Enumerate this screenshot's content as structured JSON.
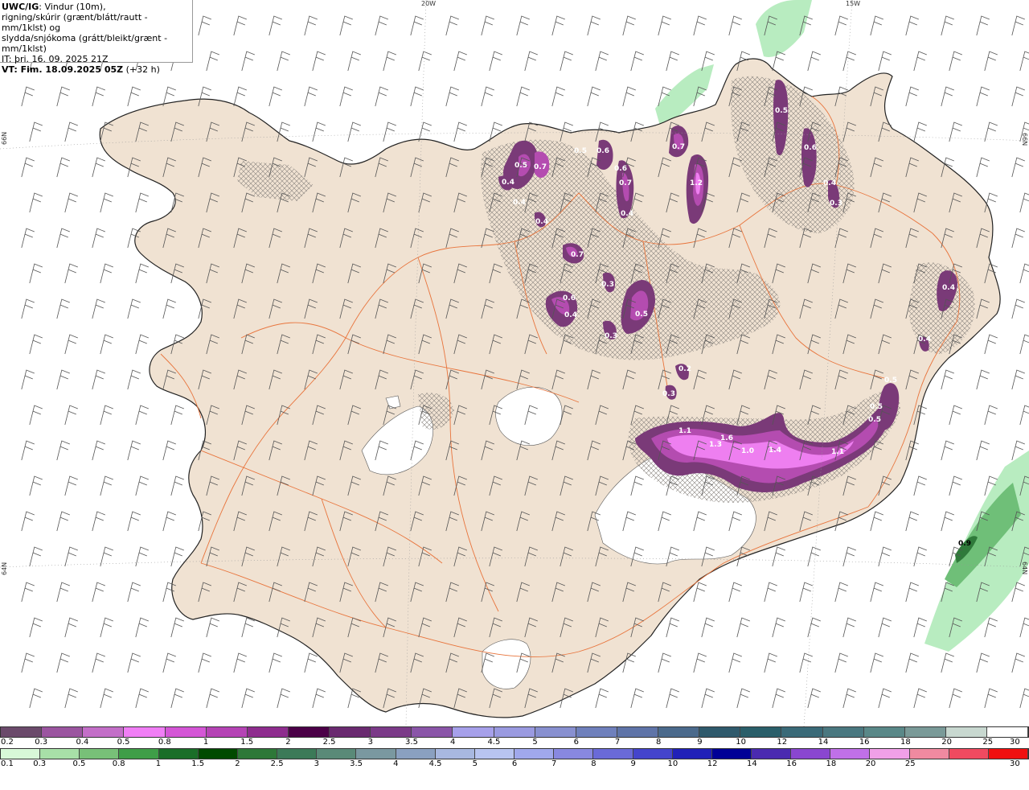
{
  "info": {
    "model": "UWC/IG",
    "title_rest": ": Vindur (10m),",
    "line2": "rigning/skúrir (grænt/blátt/rautt - mm/1klst) og",
    "line3": "slydda/snjókoma (grátt/bleikt/grænt - mm/1klst)",
    "it": "IT: þri. 16. 09. 2025 21Z",
    "vt_bold": "VT: Fim. 18.09.2025 05Z",
    "vt_rest": " (+32 h)"
  },
  "coords": {
    "lon_20": "20W",
    "lon_15": "15W",
    "lat_66_left": "66N",
    "lat_66_right": "66N",
    "lat_64_left": "64N",
    "lat_64_right": "64N"
  },
  "colors": {
    "land": "#f0e2d2",
    "ice": "#ffffff",
    "roads": "#e8743c",
    "wind": "#555555",
    "snow_dark": "#7a3a78",
    "snow_mid": "#b44cb0",
    "snow_light": "#ee7ff0",
    "rain_light": "#b8ecc0",
    "rain_mid": "#6fbf78",
    "rain_dark": "#2f7a3a"
  },
  "precip_labels": [
    {
      "id": "a1",
      "text": "0.5"
    },
    {
      "id": "a2",
      "text": "0.7"
    },
    {
      "id": "a3",
      "text": "0.4"
    },
    {
      "id": "a4",
      "text": "0.4"
    },
    {
      "id": "a5",
      "text": "0.4"
    },
    {
      "id": "a6",
      "text": "0.5"
    },
    {
      "id": "a7",
      "text": "0.6"
    },
    {
      "id": "a8",
      "text": "0.6"
    },
    {
      "id": "a9",
      "text": "0.7"
    },
    {
      "id": "a10",
      "text": "0.4"
    },
    {
      "id": "a11",
      "text": "0.7"
    },
    {
      "id": "a12",
      "text": "1.2"
    },
    {
      "id": "a13",
      "text": "0.5"
    },
    {
      "id": "a14",
      "text": "0.6"
    },
    {
      "id": "a15",
      "text": "0.4"
    },
    {
      "id": "a16",
      "text": "0.3"
    },
    {
      "id": "a17",
      "text": "0.7"
    },
    {
      "id": "a18",
      "text": "0.3"
    },
    {
      "id": "a19",
      "text": "0.6"
    },
    {
      "id": "a20",
      "text": "0.4"
    },
    {
      "id": "a21",
      "text": "0.5"
    },
    {
      "id": "a22",
      "text": "0.3"
    },
    {
      "id": "a23",
      "text": "0.4"
    },
    {
      "id": "a24",
      "text": "0.4"
    },
    {
      "id": "a25",
      "text": "0.2"
    },
    {
      "id": "a26",
      "text": "0.3"
    },
    {
      "id": "a27",
      "text": "0.5"
    },
    {
      "id": "a28",
      "text": "0.5"
    },
    {
      "id": "a29",
      "text": "0.5"
    },
    {
      "id": "a30",
      "text": "1.1"
    },
    {
      "id": "a31",
      "text": "1.3"
    },
    {
      "id": "a32",
      "text": "1.6"
    },
    {
      "id": "a33",
      "text": "1.0"
    },
    {
      "id": "a34",
      "text": "1.4"
    },
    {
      "id": "a35",
      "text": "1.1"
    },
    {
      "id": "a36",
      "text": "0.9"
    }
  ],
  "scale_snow": {
    "colors": [
      "#6b4a6b",
      "#9b55a0",
      "#c36fc8",
      "#f07ef5",
      "#d456d6",
      "#b543b5",
      "#8e2c8e",
      "#4b0047",
      "#6a2a70",
      "#7b3a88",
      "#8a55a8",
      "#a6a0ea",
      "#9a9ae0",
      "#8890d0",
      "#6f80bc",
      "#5f74a8",
      "#4b6a8c",
      "#2f5a6c",
      "#2a5f6a",
      "#3a6a78",
      "#4a7880",
      "#5a8888",
      "#7a9a98",
      "#c8d8d0",
      "#ffffff"
    ],
    "labels": [
      "0.2",
      "0.3",
      "0.4",
      "0.5",
      "0.8",
      "1",
      "1.5",
      "2",
      "2.5",
      "3",
      "3.5",
      "4",
      "4.5",
      "5",
      "6",
      "7",
      "8",
      "9",
      "10",
      "12",
      "14",
      "16",
      "18",
      "20",
      "25",
      "30"
    ]
  },
  "scale_rain": {
    "colors": [
      "#d8f8d8",
      "#a8e0a8",
      "#78c078",
      "#3f9e48",
      "#1a6e28",
      "#004a00",
      "#2d7838",
      "#3c7a58",
      "#5a8a78",
      "#7a98a0",
      "#8aa0c0",
      "#a8b8e0",
      "#b8c4f0",
      "#a0a8ec",
      "#8888e0",
      "#6a6ad8",
      "#4444cc",
      "#2020b8",
      "#000096",
      "#4a2ab0",
      "#8a46d0",
      "#c070e8",
      "#f0a0e8",
      "#f08aa0",
      "#f04a60",
      "#f01010"
    ],
    "labels": [
      "0.1",
      "0.3",
      "0.5",
      "0.8",
      "1",
      "1.5",
      "2",
      "2.5",
      "3",
      "3.5",
      "4",
      "4.5",
      "5",
      "6",
      "7",
      "8",
      "9",
      "10",
      "12",
      "14",
      "16",
      "18",
      "20",
      "25",
      "30"
    ]
  }
}
